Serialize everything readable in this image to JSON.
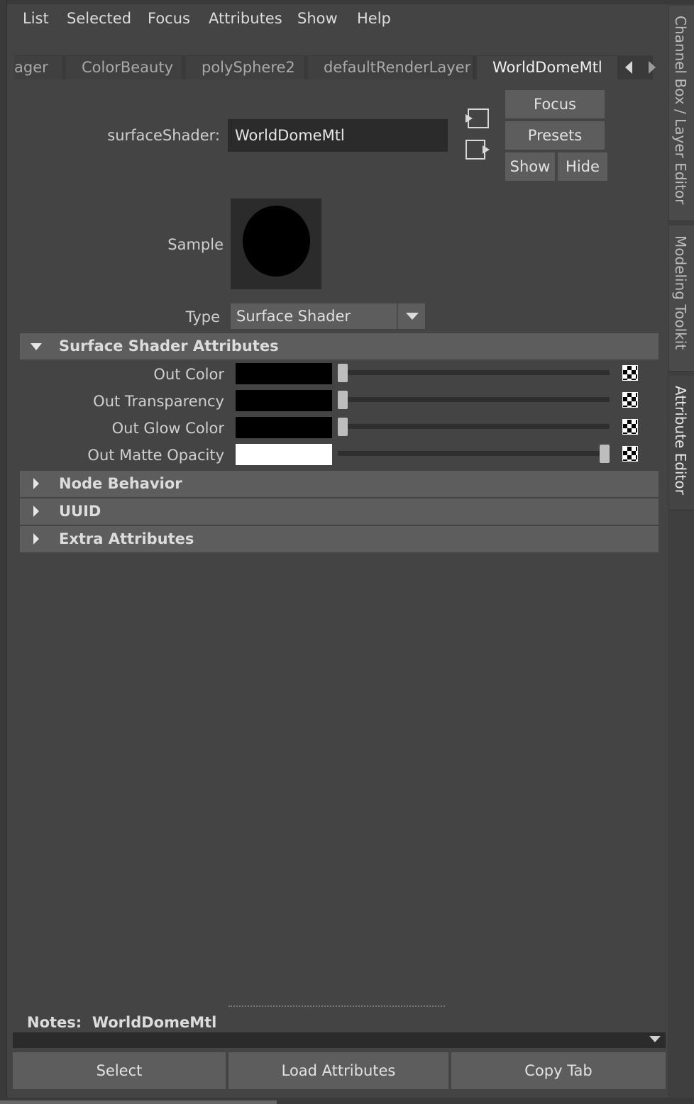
{
  "menu": [
    "List",
    "Selected",
    "Focus",
    "Attributes",
    "Show",
    "Help"
  ],
  "tabs": [
    "ager",
    "ColorBeauty",
    "polySphere2",
    "defaultRenderLayer",
    "WorldDomeMtl"
  ],
  "side_tabs": [
    "Channel Box / Layer Editor",
    "Modeling Toolkit",
    "Attribute Editor"
  ],
  "node": {
    "label": "surfaceShader:",
    "value": "WorldDomeMtl"
  },
  "buttons": {
    "focus": "Focus",
    "presets": "Presets",
    "show": "Show",
    "hide": "Hide"
  },
  "sample_label": "Sample",
  "type": {
    "label": "Type",
    "value": "Surface Shader"
  },
  "sections": {
    "surface": "Surface Shader Attributes",
    "node_behavior": "Node Behavior",
    "uuid": "UUID",
    "extra": "Extra Attributes"
  },
  "attributes": [
    {
      "label": "Out Color",
      "color": "#000000",
      "slider": 0.0
    },
    {
      "label": "Out Transparency",
      "color": "#000000",
      "slider": 0.0
    },
    {
      "label": "Out Glow Color",
      "color": "#000000",
      "slider": 0.0
    },
    {
      "label": "Out Matte Opacity",
      "color": "#ffffff",
      "slider": 1.0
    }
  ],
  "notes": {
    "label": "Notes:",
    "value": "WorldDomeMtl"
  },
  "bottom_buttons": [
    "Select",
    "Load Attributes",
    "Copy Tab"
  ],
  "colors": {
    "background": "#444444",
    "button": "#5d5d5d",
    "field": "#2b2b2b"
  }
}
